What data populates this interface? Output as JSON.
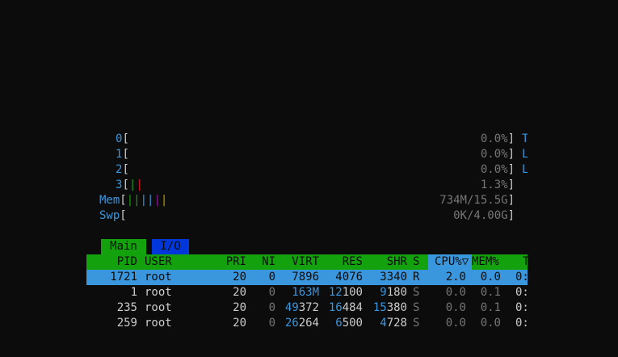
{
  "meters": {
    "cpus": [
      {
        "label": "0",
        "value": "0.0%"
      },
      {
        "label": "1",
        "value": "0.0%"
      },
      {
        "label": "2",
        "value": "0.0%"
      },
      {
        "label": "3",
        "value": "1.3%"
      }
    ],
    "mem": {
      "label": "Mem",
      "value": "734M/15.5G"
    },
    "swp": {
      "label": "Swp",
      "value": "0K/4.00G"
    },
    "right_clipped": [
      "T",
      "L",
      "L"
    ],
    "colors": {
      "green": "#13a10e",
      "red": "#c50f1f",
      "blue": "#3a96dd",
      "magenta": "#881798",
      "yellow": "#c19c00"
    }
  },
  "tabs": {
    "main": "Main",
    "io": "I/O"
  },
  "columns": {
    "pid": "PID",
    "user": "USER",
    "pri": "PRI",
    "ni": "NI",
    "virt": "VIRT",
    "res": "RES",
    "shr": "SHR",
    "s": "S",
    "cpu": "CPU%▽",
    "mem": "MEM%",
    "time": "T"
  },
  "processes": [
    {
      "pid": "1721",
      "user": "root",
      "pri": "20",
      "ni": "0",
      "virt_hi": "",
      "virt_lo": "7896",
      "res_hi": "",
      "res_lo": "4076",
      "shr_hi": "",
      "shr_lo": "3340",
      "s": "R",
      "cpu": "2.0",
      "mem": "0.0",
      "time": "0:"
    },
    {
      "pid": "1",
      "user": "root",
      "pri": "20",
      "ni": "0",
      "virt_hi": "163M",
      "virt_lo": "",
      "res_hi": "12",
      "res_lo": "100",
      "shr_hi": "9",
      "shr_lo": "180",
      "s": "S",
      "cpu": "0.0",
      "mem": "0.1",
      "time": "0:"
    },
    {
      "pid": "235",
      "user": "root",
      "pri": "20",
      "ni": "0",
      "virt_hi": "49",
      "virt_lo": "372",
      "res_hi": "16",
      "res_lo": "484",
      "shr_hi": "15",
      "shr_lo": "380",
      "s": "S",
      "cpu": "0.0",
      "mem": "0.1",
      "time": "0:"
    },
    {
      "pid": "259",
      "user": "root",
      "pri": "20",
      "ni": "0",
      "virt_hi": "26",
      "virt_lo": "264",
      "res_hi": "6",
      "res_lo": "500",
      "shr_hi": "4",
      "shr_lo": "728",
      "s": "S",
      "cpu": "0.0",
      "mem": "0.0",
      "time": "0:"
    }
  ]
}
